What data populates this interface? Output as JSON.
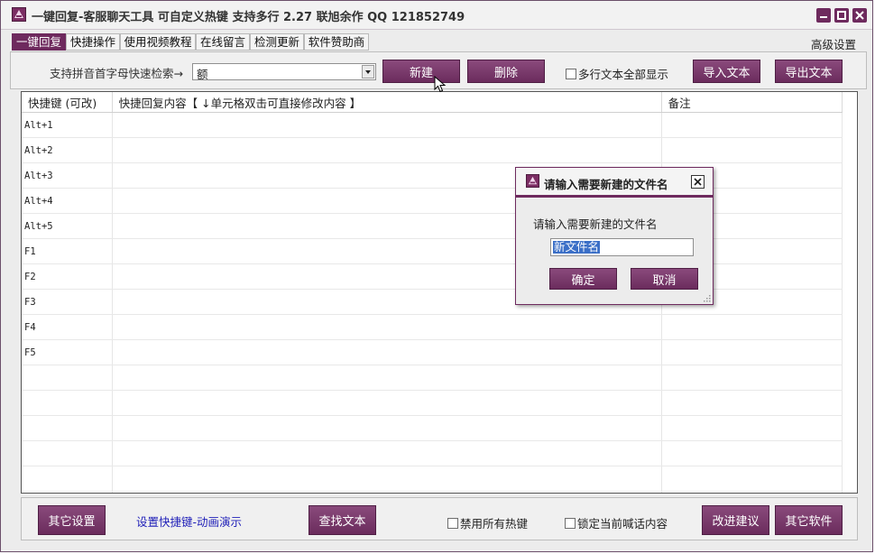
{
  "titlebar": {
    "title": "一键回复-客服聊天工具   可自定义热键   支持多行   2.27        联旭余作    QQ 121852749",
    "buttons": [
      "minimize-icon",
      "maximize-icon",
      "close-icon"
    ]
  },
  "menu": {
    "tabs": [
      "一键回复",
      "快捷操作",
      "使用视频教程",
      "在线留言",
      "检测更新",
      "软件赞助商"
    ],
    "advanced": "高级设置"
  },
  "toolbar": {
    "search_label": "支持拼音首字母快速检索→",
    "combo_value": "额",
    "new_label": "新建",
    "delete_label": "删除",
    "multiline_label": "多行文本全部显示",
    "import_label": "导入文本",
    "export_label": "导出文本"
  },
  "grid": {
    "headers": [
      "快捷键 (可改)",
      "快捷回复内容【 ↓单元格双击可直接修改内容 】",
      "备注"
    ],
    "rows": [
      "Alt+1",
      "Alt+2",
      "Alt+3",
      "Alt+4",
      "Alt+5",
      "F1",
      "F2",
      "F3",
      "F4",
      "F5",
      "",
      "",
      "",
      "",
      "",
      ""
    ]
  },
  "bottom": {
    "other_settings": "其它设置",
    "hotkey_demo": "设置快捷键-动画演示",
    "find_text": "查找文本",
    "disable_hotkeys": "禁用所有热键",
    "lock_content": "锁定当前喊话内容",
    "suggestions": "改进建议",
    "other_software": "其它软件"
  },
  "dialog": {
    "title": "请输入需要新建的文件名",
    "prompt": "请输入需要新建的文件名",
    "input_value": "新文件名",
    "ok_label": "确定",
    "cancel_label": "取消"
  },
  "colors": {
    "accent": "#6e2a5e",
    "link": "#1f1fb8"
  }
}
